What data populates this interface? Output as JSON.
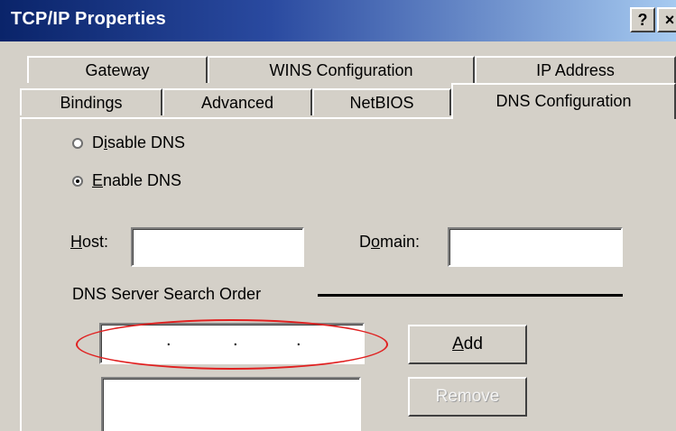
{
  "window": {
    "title": "TCP/IP Properties",
    "help_button": "?",
    "close_button": "×"
  },
  "tabs": {
    "row1": [
      "Gateway",
      "WINS Configuration",
      "IP Address"
    ],
    "row2": [
      "Bindings",
      "Advanced",
      "NetBIOS",
      "DNS Configuration"
    ],
    "selected": "DNS Configuration"
  },
  "dns": {
    "disable_label_pre": "D",
    "disable_label_u": "i",
    "disable_label_post": "sable DNS",
    "enable_label_u": "E",
    "enable_label_post": "nable DNS",
    "selected": "Enable DNS",
    "host_label_u": "H",
    "host_label_post": "ost:",
    "host_value": "",
    "domain_label_pre": "D",
    "domain_label_u": "o",
    "domain_label_post": "main:",
    "domain_value": "",
    "search_order_label": "DNS Server Search Order",
    "server_ip_dots": [
      ".",
      ".",
      "."
    ],
    "add_button_u": "A",
    "add_button_post": "dd",
    "remove_button": "Remove"
  },
  "colors": {
    "title_bar_start": "#0a246a",
    "title_bar_end": "#a6caf0",
    "dialog_face": "#d4d0c8",
    "highlight_ellipse": "#e02020"
  }
}
